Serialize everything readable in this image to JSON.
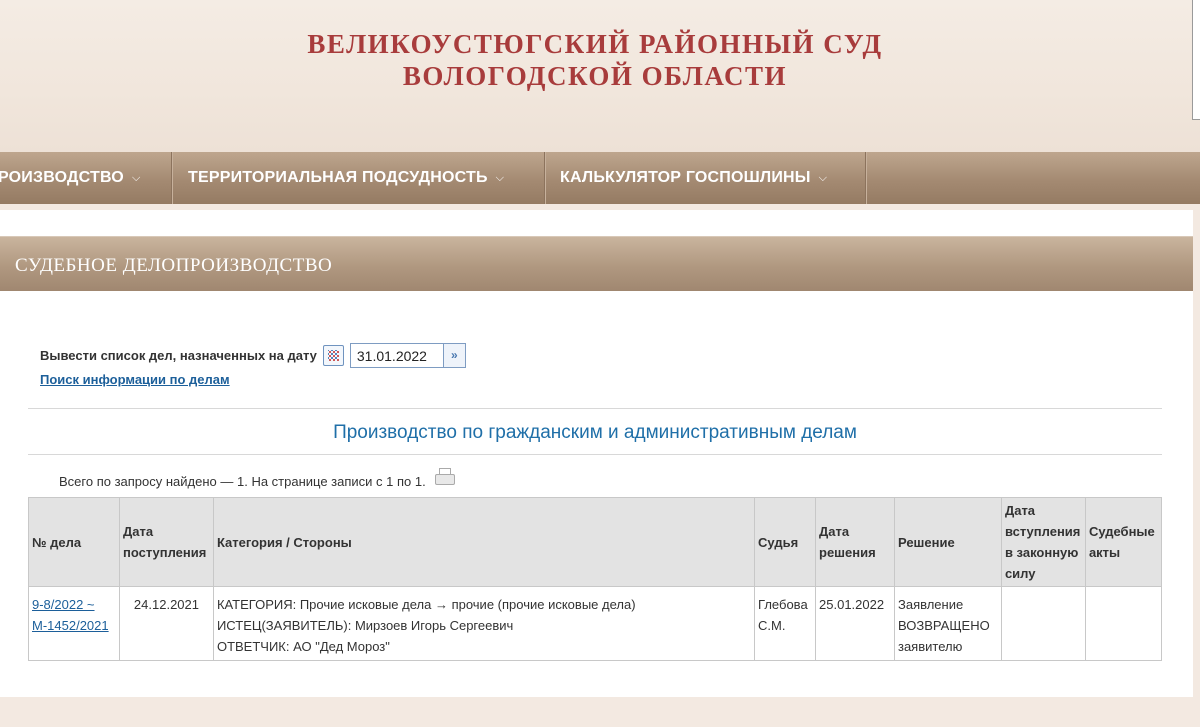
{
  "header": {
    "title_line1": "ВЕЛИКОУСТЮГСКИЙ РАЙОННЫЙ СУД",
    "title_line2": "ВОЛОГОДСКОЙ ОБЛАСТИ"
  },
  "nav": {
    "items": [
      {
        "label": "РОИЗВОДСТВО"
      },
      {
        "label": "ТЕРРИТОРИАЛЬНАЯ ПОДСУДНОСТЬ"
      },
      {
        "label": "КАЛЬКУЛЯТОР ГОСПОШЛИНЫ"
      }
    ],
    "chevron": "⌵"
  },
  "section": {
    "title": "СУДЕБНОЕ ДЕЛОПРОИЗВОДСТВО"
  },
  "date_filter": {
    "label": "Вывести список дел, назначенных на дату",
    "value": "31.01.2022",
    "go_symbol": "»",
    "calendar_icon": "calendar-icon",
    "go_icon": "double-arrow-icon"
  },
  "search_link": "Поиск информации по делам",
  "table_title": "Производство по гражданским и административным делам",
  "found_text": "Всего по запросу найдено — 1. На странице записи с 1 по 1.",
  "table": {
    "headers": [
      "№ дела",
      "Дата поступления",
      "Категория / Стороны",
      "Судья",
      "Дата решения",
      "Решение",
      "Дата вступления в законную силу",
      "Судебные акты"
    ],
    "rows": [
      {
        "case_no": "9-8/2022 ~ М-1452/2021",
        "received": "24.12.2021",
        "category": "КАТЕГОРИЯ: Прочие исковые дела → прочие (прочие исковые дела)",
        "plaintiff": "ИСТЕЦ(ЗАЯВИТЕЛЬ): Мирзоев Игорь Сергеевич",
        "defendant": "ОТВЕТЧИК: АО \"Дед Мороз\"",
        "judge": "Глебова С.М.",
        "decision_date": "25.01.2022",
        "decision": "Заявление ВОЗВРАЩЕНО заявителю",
        "effective_date": "",
        "acts": ""
      }
    ]
  },
  "colors": {
    "title_red": "#a83c3c",
    "nav_brown": "#a48a72",
    "link_blue": "#1c5f9a",
    "heading_blue": "#1f6fa8"
  }
}
